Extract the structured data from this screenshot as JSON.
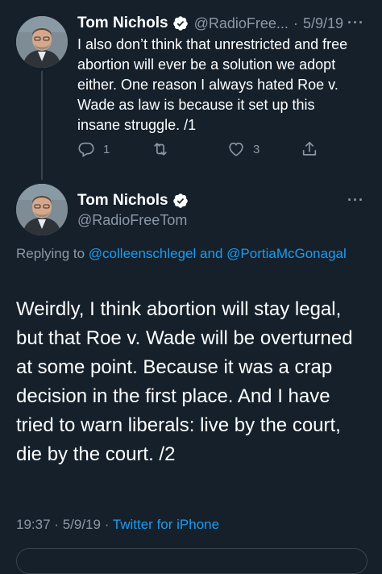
{
  "tweet1": {
    "name": "Tom Nichols",
    "handle": "@RadioFree...",
    "separator": "·",
    "date": "5/9/19",
    "text": "I also don’t think that unrestricted and free abortion will ever be a solution we adopt either. One reason I always hated Roe v. Wade as law is because it set up this insane struggle. /1",
    "reply_count": "1",
    "like_count": "3",
    "more": "···"
  },
  "tweet2": {
    "name": "Tom Nichols",
    "handle": "@RadioFreeTom",
    "more": "···",
    "replying_prefix": "Replying to",
    "reply_user1": "@colleenschlegel",
    "reply_and": "and",
    "reply_user2": "@PortiaMcGonagal",
    "text": "Weirdly, I think abortion will stay legal, but that Roe v. Wade will be overturned at some point. Because it was a crap decision in the first place.  And I have tried to warn liberals: live by the court, die by the court. /2",
    "time": "19:37",
    "date": "5/9/19",
    "dot": "·",
    "source": "Twitter for iPhone"
  },
  "colors": {
    "background": "#15202b",
    "accent": "#1d9bf0",
    "secondary_text": "#8b98a5"
  }
}
